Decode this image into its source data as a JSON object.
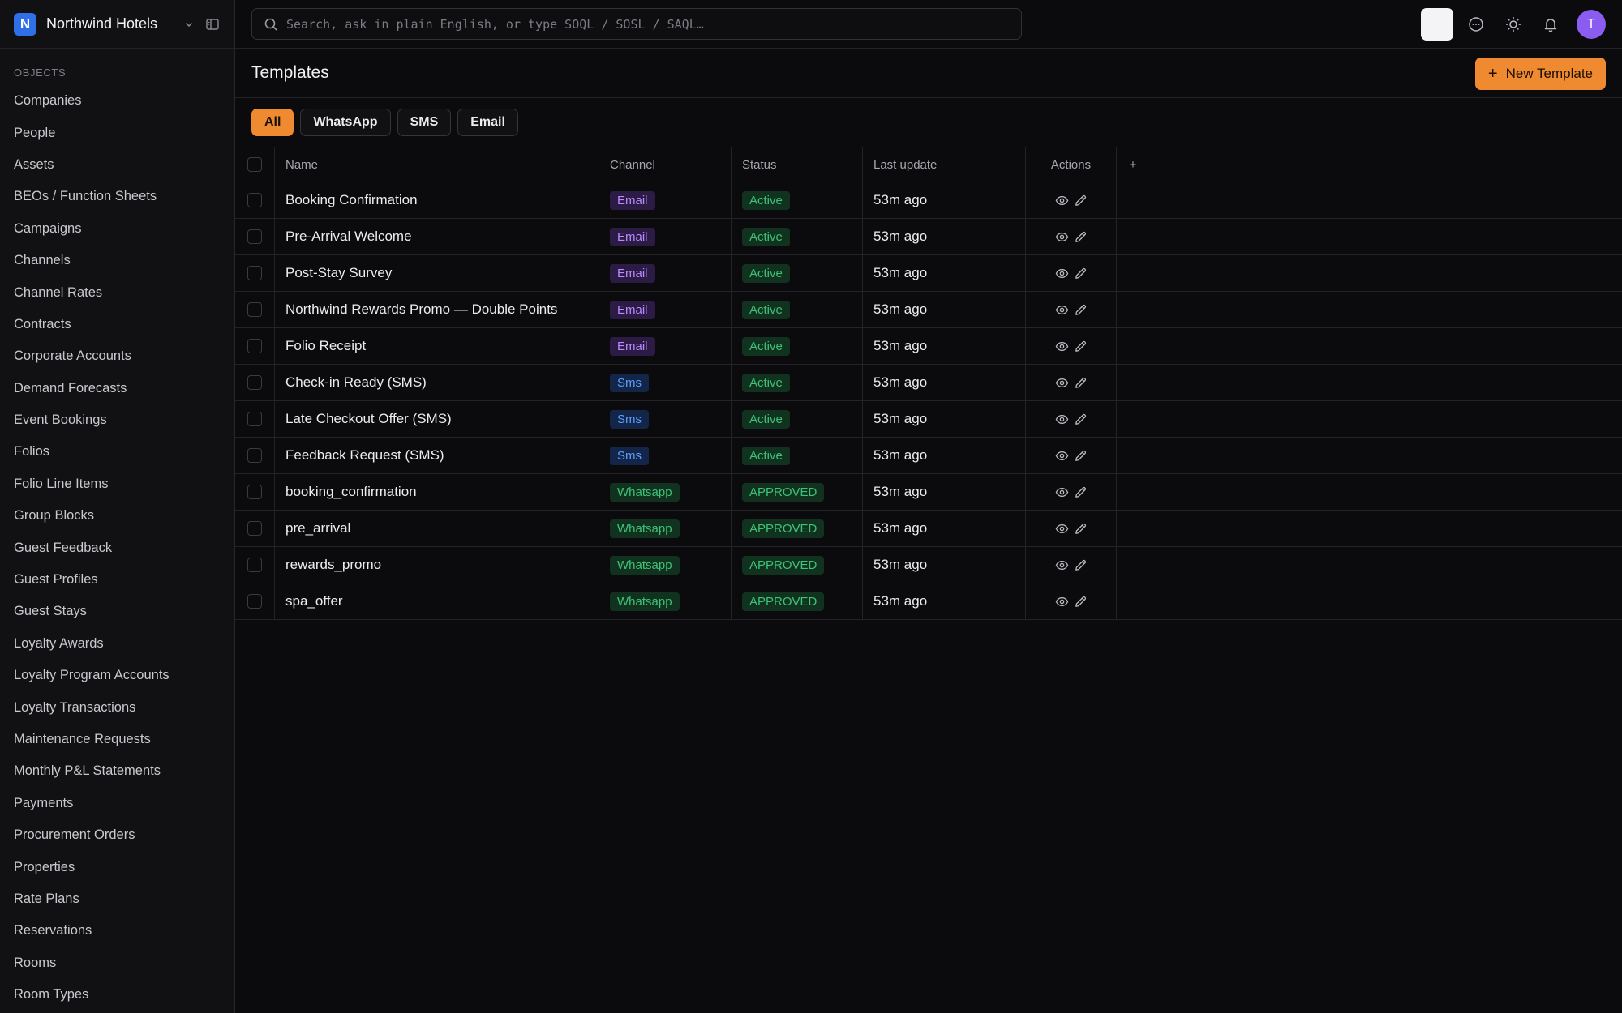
{
  "app": {
    "name": "Northwind Hotels",
    "logo_letter": "N"
  },
  "sidebar": {
    "section_label": "OBJECTS",
    "items": [
      "Companies",
      "People",
      "Assets",
      "BEOs / Function Sheets",
      "Campaigns",
      "Channels",
      "Channel Rates",
      "Contracts",
      "Corporate Accounts",
      "Demand Forecasts",
      "Event Bookings",
      "Folios",
      "Folio Line Items",
      "Group Blocks",
      "Guest Feedback",
      "Guest Profiles",
      "Guest Stays",
      "Loyalty Awards",
      "Loyalty Program Accounts",
      "Loyalty Transactions",
      "Maintenance Requests",
      "Monthly P&L Statements",
      "Payments",
      "Procurement Orders",
      "Properties",
      "Rate Plans",
      "Reservations",
      "Rooms",
      "Room Types"
    ]
  },
  "topbar": {
    "search_placeholder": "Search, ask in plain English, or type SOQL / SOSL / SAQL…",
    "avatar_letter": "T"
  },
  "header": {
    "title": "Templates",
    "new_button": "New Template"
  },
  "filters": [
    {
      "label": "All",
      "active": true
    },
    {
      "label": "WhatsApp",
      "active": false
    },
    {
      "label": "SMS",
      "active": false
    },
    {
      "label": "Email",
      "active": false
    }
  ],
  "table": {
    "columns": {
      "name": "Name",
      "channel": "Channel",
      "status": "Status",
      "last_update": "Last update",
      "actions": "Actions"
    },
    "add_column_icon": "+",
    "rows": [
      {
        "name": "Booking Confirmation",
        "channel": "Email",
        "status": "Active",
        "last_update": "53m ago"
      },
      {
        "name": "Pre-Arrival Welcome",
        "channel": "Email",
        "status": "Active",
        "last_update": "53m ago"
      },
      {
        "name": "Post-Stay Survey",
        "channel": "Email",
        "status": "Active",
        "last_update": "53m ago"
      },
      {
        "name": "Northwind Rewards Promo — Double Points",
        "channel": "Email",
        "status": "Active",
        "last_update": "53m ago"
      },
      {
        "name": "Folio Receipt",
        "channel": "Email",
        "status": "Active",
        "last_update": "53m ago"
      },
      {
        "name": "Check-in Ready (SMS)",
        "channel": "Sms",
        "status": "Active",
        "last_update": "53m ago"
      },
      {
        "name": "Late Checkout Offer (SMS)",
        "channel": "Sms",
        "status": "Active",
        "last_update": "53m ago"
      },
      {
        "name": "Feedback Request (SMS)",
        "channel": "Sms",
        "status": "Active",
        "last_update": "53m ago"
      },
      {
        "name": "booking_confirmation",
        "channel": "Whatsapp",
        "status": "APPROVED",
        "last_update": "53m ago"
      },
      {
        "name": "pre_arrival",
        "channel": "Whatsapp",
        "status": "APPROVED",
        "last_update": "53m ago"
      },
      {
        "name": "rewards_promo",
        "channel": "Whatsapp",
        "status": "APPROVED",
        "last_update": "53m ago"
      },
      {
        "name": "spa_offer",
        "channel": "Whatsapp",
        "status": "APPROVED",
        "last_update": "53m ago"
      }
    ]
  },
  "colors": {
    "accent": "#f08a30",
    "brand": "#2f6fe8",
    "avatar": "#8a5cf0"
  }
}
